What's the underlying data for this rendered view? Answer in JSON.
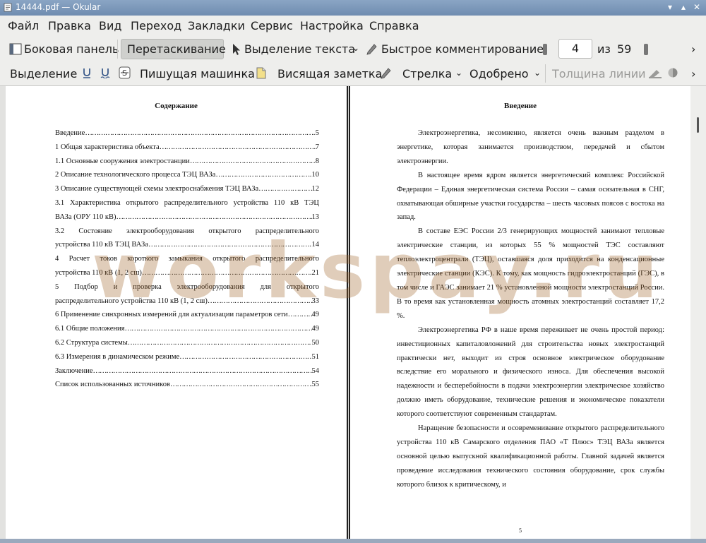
{
  "window": {
    "title": "14444.pdf — Okular"
  },
  "menu": [
    "Файл",
    "Правка",
    "Вид",
    "Переход",
    "Закладки",
    "Сервис",
    "Настройка",
    "Справка"
  ],
  "toolbar1": {
    "sidebar": "Боковая панель",
    "drag": "Перетаскивание",
    "text_select": "Выделение текста",
    "quick_comment": "Быстрое комментирование",
    "page_current": "4",
    "page_of": "из",
    "page_total": "59"
  },
  "toolbar2": {
    "highlight": "Выделение",
    "typewriter": "Пишущая машинка",
    "sticky": "Висящая заметка",
    "arrow": "Стрелка",
    "approved": "Одобрено",
    "line_width": "Толщина линии"
  },
  "left_page": {
    "title": "Содержание",
    "toc": [
      {
        "t": "Введение",
        "n": "5"
      },
      {
        "t": "1 Общая характеристика объекта",
        "n": "7"
      },
      {
        "t": "1.1 Основные сооружения электростанции",
        "n": "8"
      },
      {
        "t": "2 Описание технологического процесса ТЭЦ ВАЗа",
        "n": "10"
      },
      {
        "t": "3 Описание существующей схемы электроснабжения ТЭЦ ВАЗа",
        "n": "12"
      },
      {
        "t1": "3.1 Характеристика открытого распределительного устройства 110 кВ ТЭЦ",
        "t": "ВАЗа (ОРУ 110 кВ)",
        "n": "13"
      },
      {
        "t1": "3.2 Состояние электрооборудования открытого распределительного",
        "t": "устройства 110 кВ ТЭЦ ВАЗа",
        "n": "14"
      },
      {
        "t1": "4 Расчет токов короткого замыкания открытого распределительного",
        "t": "устройства 110 кВ (1, 2 сш)",
        "n": "21"
      },
      {
        "t1": "5 Подбор и проверка электрооборудования для открытого",
        "t": "распределительного устройства 110 кВ (1, 2 сш)",
        "n": "33"
      },
      {
        "t": "6 Применение синхронных измерений для актуализации параметров сети",
        "n": "49"
      },
      {
        "t": "6.1 Общие положения",
        "n": "49"
      },
      {
        "t": "6.2 Структура системы",
        "n": "50"
      },
      {
        "t": "6.3 Измерения в динамическом режиме",
        "n": "51"
      },
      {
        "t": "Заключение",
        "n": "54"
      },
      {
        "t": "Список использованных источников",
        "n": "55"
      }
    ]
  },
  "right_page": {
    "title": "Введение",
    "paragraphs": [
      "Электроэнергетика, несомненно, является очень важным разделом в энергетике, которая занимается производством, передачей и сбытом электроэнергии.",
      "В настоящее время ядром является энергетический комплекс Российской Федерации – Единая энергетическая система России – самая осязательная в СНГ, охватывающая обширные участки государства – шесть часовых поясов с востока на запад.",
      "В составе ЕЭС России 2/3 генерирующих мощностей занимают тепловые электрические станции, из которых 55 % мощностей ТЭС составляют теплоэлектроцентрали (ТЭЦ), оставшаяся доля приходится на конденсационные электрические станции (КЭС). К тому, как мощность гидроэлектростанций (ГЭС), в том числе и ГАЭС занимает 21 % установленной мощности электростанций России. В то время как установленная мощность атомных электростанций составляет 17,2 %.",
      "Электроэнергетика РФ в наше время переживает не очень простой период: инвестиционных капиталовложений для строительства новых электростанций практически нет, выходит из строя основное электрическое оборудование вследствие его морального и физического износа. Для обеспечения высокой надежности и бесперебойности в подачи электроэнергии электрическое хозяйство должно иметь оборудование, технические решения и экономическое показатели которого соответствуют современным стандартам.",
      "Наращение безопасности и осовременивание открытого распределительного устройства 110 кВ Самарского отделения ПАО «Т Плюс» ТЭЦ ВАЗа является основной целью выпускной квалификационной работы. Главной задачей является проведение исследования технического состояния оборудование, срок службы которого близок к критическому, и"
    ],
    "page_number": "5"
  },
  "watermark": "workspay.ru"
}
